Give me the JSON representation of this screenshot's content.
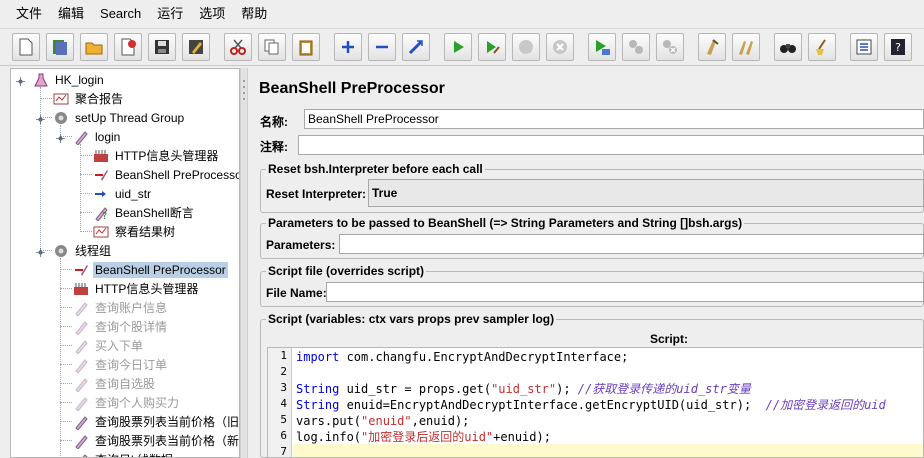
{
  "menu": [
    "文件",
    "编辑",
    "Search",
    "运行",
    "选项",
    "帮助"
  ],
  "toolbar": {
    "buttons": [
      "new-icon",
      "templates-icon",
      "open-icon",
      "close-icon",
      "save-icon",
      "save-as-icon",
      "cut-icon",
      "copy-icon",
      "paste-icon",
      "expand-icon",
      "collapse-icon",
      "toggle-icon",
      "start-icon",
      "start-no-pause-icon",
      "stop-icon",
      "shutdown-icon",
      "remote-start-icon",
      "remote-stop-icon",
      "remote-shutdown-icon",
      "clear-icon",
      "clear-all-icon",
      "search-icon",
      "reset-search-icon",
      "function-helper-icon",
      "help-icon"
    ]
  },
  "tree": {
    "items": [
      {
        "label": "HK_login",
        "icon": "test-plan-icon",
        "level": 0,
        "state": "normal"
      },
      {
        "label": "聚合报告",
        "icon": "listener-icon",
        "level": 1,
        "state": "normal"
      },
      {
        "label": "setUp Thread Group",
        "icon": "thread-group-icon",
        "level": 1,
        "state": "normal"
      },
      {
        "label": "login",
        "icon": "sampler-icon",
        "level": 2,
        "state": "normal"
      },
      {
        "label": "HTTP信息头管理器",
        "icon": "config-icon",
        "level": 3,
        "state": "normal"
      },
      {
        "label": "BeanShell PreProcessor",
        "icon": "preprocessor-icon",
        "level": 3,
        "state": "normal"
      },
      {
        "label": "uid_str",
        "icon": "postprocessor-icon",
        "level": 3,
        "state": "normal"
      },
      {
        "label": "BeanShell断言",
        "icon": "assertion-icon",
        "level": 3,
        "state": "normal"
      },
      {
        "label": "察看结果树",
        "icon": "listener-icon",
        "level": 3,
        "state": "normal"
      },
      {
        "label": "线程组",
        "icon": "thread-group-icon",
        "level": 1,
        "state": "normal"
      },
      {
        "label": "BeanShell PreProcessor",
        "icon": "preprocessor-icon",
        "level": 2,
        "state": "selected"
      },
      {
        "label": "HTTP信息头管理器",
        "icon": "config-icon",
        "level": 2,
        "state": "normal"
      },
      {
        "label": "查询账户信息",
        "icon": "sampler-icon",
        "level": 2,
        "state": "disabled"
      },
      {
        "label": "查询个股详情",
        "icon": "sampler-icon",
        "level": 2,
        "state": "disabled"
      },
      {
        "label": "买入下单",
        "icon": "sampler-icon",
        "level": 2,
        "state": "disabled"
      },
      {
        "label": "查询今日订单",
        "icon": "sampler-icon",
        "level": 2,
        "state": "disabled"
      },
      {
        "label": "查询自选股",
        "icon": "sampler-icon",
        "level": 2,
        "state": "disabled"
      },
      {
        "label": "查询个人购买力",
        "icon": "sampler-icon",
        "level": 2,
        "state": "disabled"
      },
      {
        "label": "查询股票列表当前价格（旧）",
        "icon": "sampler-icon",
        "level": 2,
        "state": "normal"
      },
      {
        "label": "查询股票列表当前价格（新）",
        "icon": "sampler-icon",
        "level": 2,
        "state": "normal"
      },
      {
        "label": "查询日k线数据",
        "icon": "sampler-icon",
        "level": 2,
        "state": "normal"
      }
    ]
  },
  "panel": {
    "title": "BeanShell PreProcessor",
    "name_label": "名称:",
    "name_value": "BeanShell PreProcessor",
    "comment_label": "注释:",
    "comment_value": "",
    "reset_group_title": "Reset bsh.Interpreter before each call",
    "reset_label": "Reset Interpreter:",
    "reset_value": "True",
    "params_group_title": "Parameters to be passed to BeanShell (=> String Parameters and String []bsh.args)",
    "params_label": "Parameters:",
    "params_value": "",
    "file_group_title": "Script file (overrides script)",
    "file_label": "File Name:",
    "file_value": "",
    "script_group_title": "Script (variables: ctx vars props prev sampler log)",
    "script_label": "Script:"
  },
  "script": {
    "line_numbers": [
      "1",
      "2",
      "3",
      "4",
      "5",
      "6",
      "7"
    ],
    "lines": [
      "import com.changfu.EncryptAndDecryptInterface;",
      "",
      "String uid_str = props.get(\"uid_str\"); //获取登录传递的uid_str变量",
      "String enuid=EncryptAndDecryptInterface.getEncryptUID(uid_str);  //加密登录返回的uid",
      "vars.put(\"enuid\",enuid);",
      "log.info(\"加密登录后返回的uid\"+enuid);",
      ""
    ]
  }
}
